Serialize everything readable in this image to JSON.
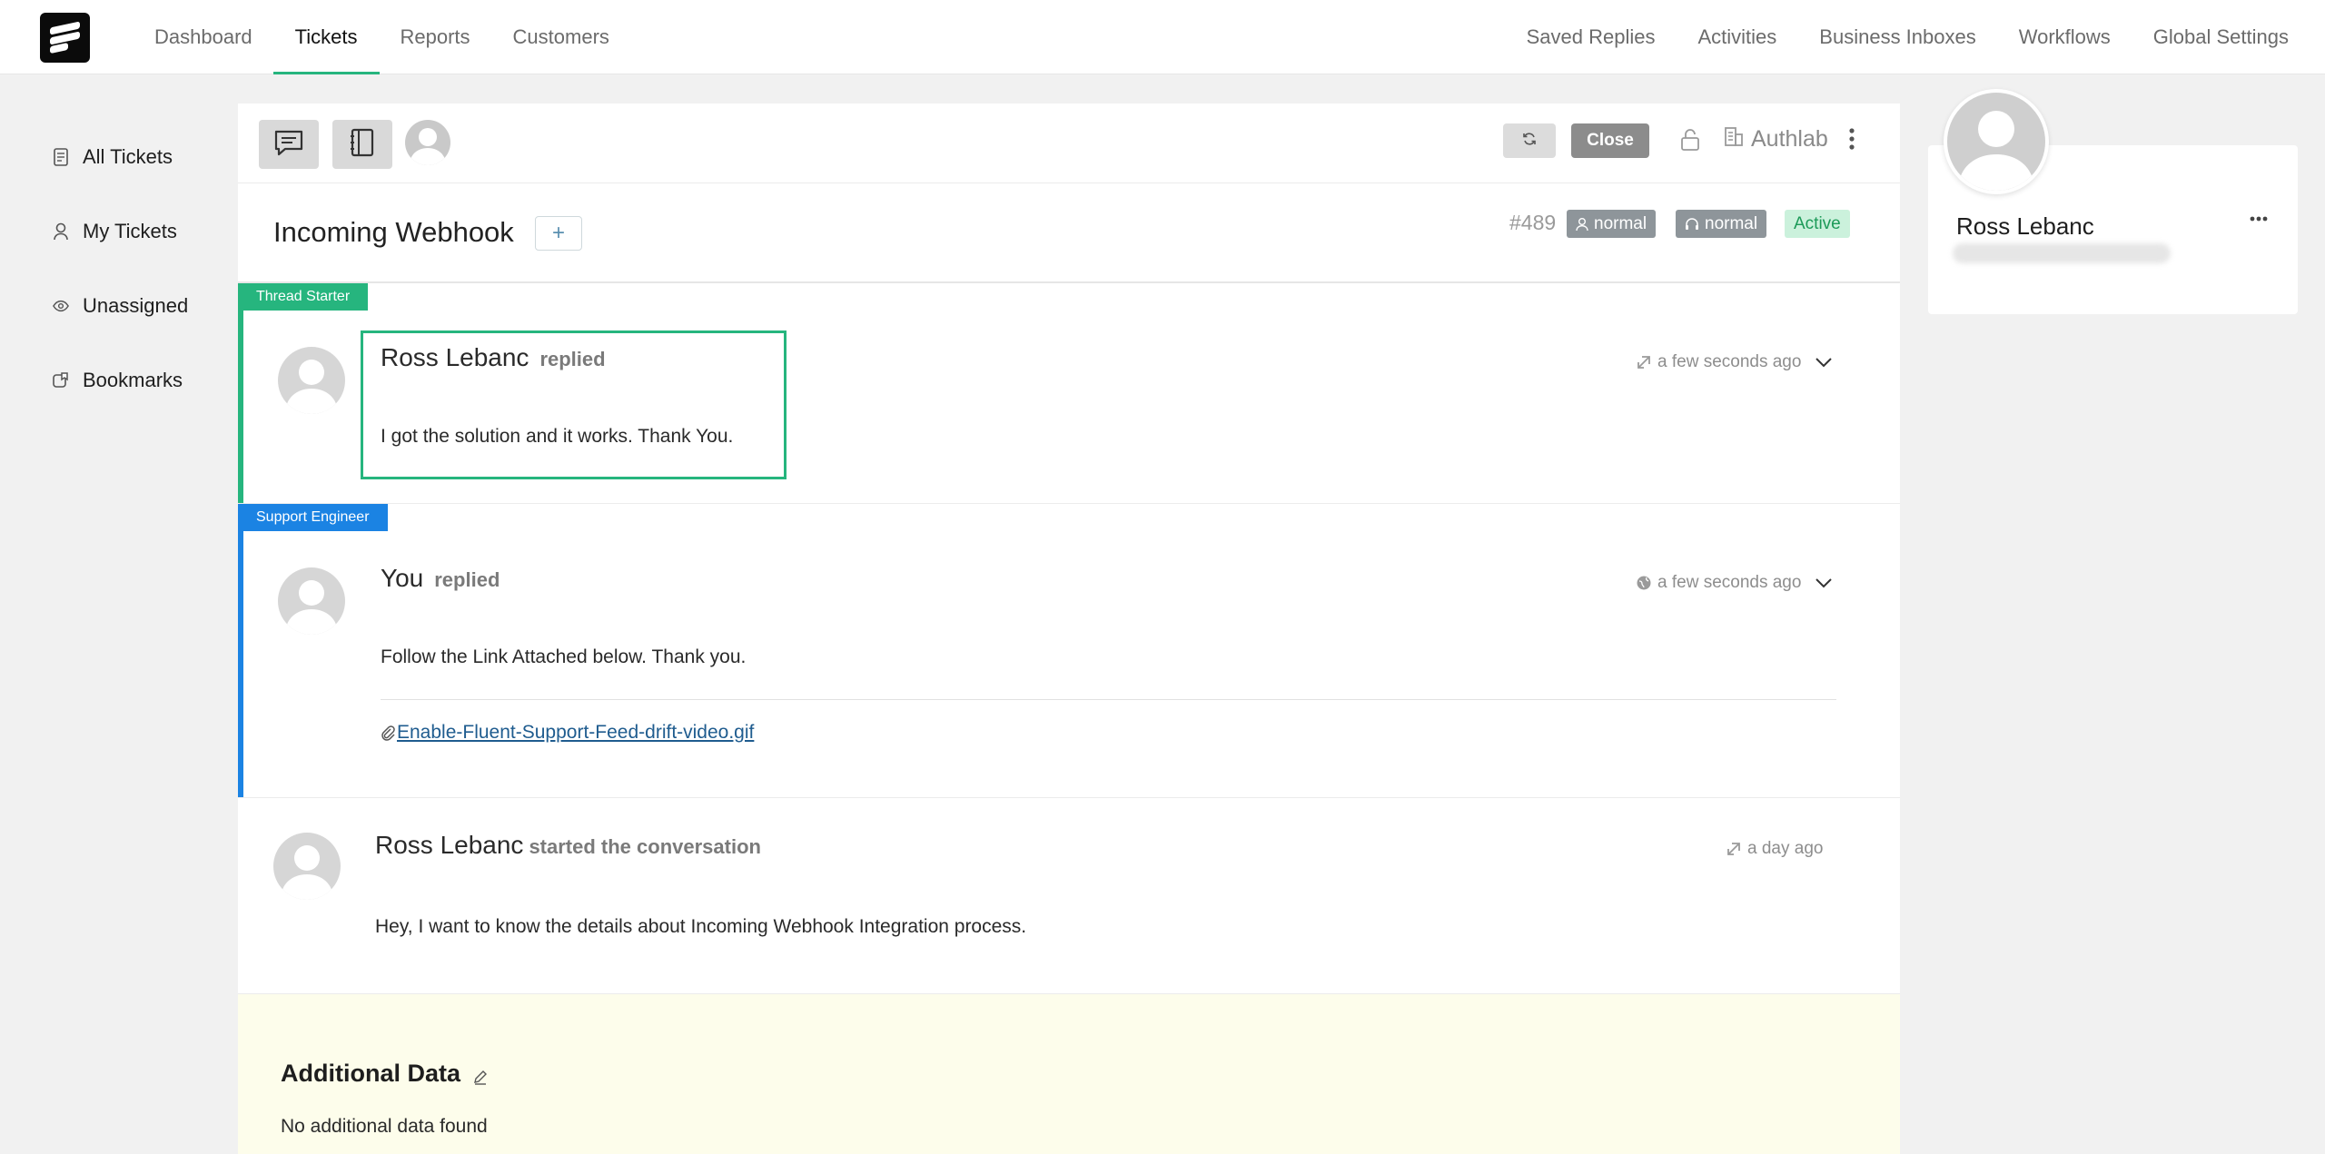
{
  "nav": {
    "left": [
      "Dashboard",
      "Tickets",
      "Reports",
      "Customers"
    ],
    "active_index": 1,
    "right": [
      "Saved Replies",
      "Activities",
      "Business Inboxes",
      "Workflows",
      "Global Settings"
    ]
  },
  "sidebar": {
    "items": [
      {
        "label": "All Tickets",
        "icon": "document-icon"
      },
      {
        "label": "My Tickets",
        "icon": "user-icon"
      },
      {
        "label": "Unassigned",
        "icon": "eye-icon"
      },
      {
        "label": "Bookmarks",
        "icon": "bookmark-icon"
      }
    ]
  },
  "toolbar": {
    "close_label": "Close",
    "org_name": "Authlab"
  },
  "ticket": {
    "title": "Incoming Webhook",
    "add_label": "+",
    "id": "#489",
    "priority_customer": "normal",
    "priority_agent": "normal",
    "status": "Active"
  },
  "threads": [
    {
      "tag": "Thread Starter",
      "tag_color": "#26b57e",
      "author": "Ross Lebanc",
      "verb": "replied",
      "time": "a few seconds ago",
      "body": "I got the solution and it works. Thank You."
    },
    {
      "tag": "Support Engineer",
      "tag_color": "#1b83e3",
      "author": "You",
      "verb": "replied",
      "time": "a few seconds ago",
      "body": "Follow the Link Attached below. Thank you.",
      "attachment": "Enable-Fluent-Support-Feed-drift-video.gif"
    },
    {
      "author": "Ross Lebanc",
      "verb": "started the conversation",
      "time": "a day ago",
      "body": "Hey, I want to know the details about Incoming Webhook Integration process."
    }
  ],
  "additional": {
    "heading": "Additional Data",
    "empty": "No additional data found"
  },
  "customer": {
    "name": "Ross Lebanc"
  },
  "colors": {
    "accent": "#26b57e",
    "support": "#1b83e3",
    "additional_bg": "#fdfdeb"
  }
}
